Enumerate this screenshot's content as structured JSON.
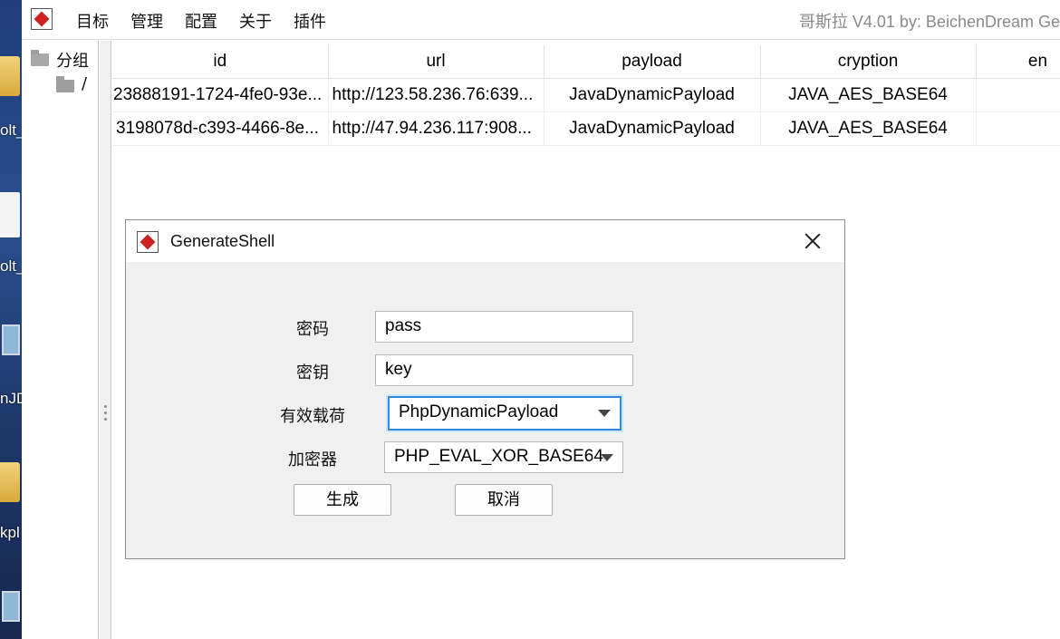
{
  "desktop": {
    "labels": [
      "olt_",
      "olt_",
      "nJD",
      "kpl"
    ]
  },
  "menubar": {
    "items": [
      "目标",
      "管理",
      "配置",
      "关于",
      "插件"
    ],
    "title": "哥斯拉   V4.01 by: BeichenDream Ge"
  },
  "tree": {
    "root_label": "分组",
    "child_label": "/"
  },
  "table": {
    "columns": [
      "id",
      "url",
      "payload",
      "cryption",
      "en"
    ],
    "rows": [
      [
        "23888191-1724-4fe0-93e...",
        "http://123.58.236.76:639...",
        "JavaDynamicPayload",
        "JAVA_AES_BASE64",
        ""
      ],
      [
        "3198078d-c393-4466-8e...",
        "http://47.94.236.117:908...",
        "JavaDynamicPayload",
        "JAVA_AES_BASE64",
        ""
      ]
    ]
  },
  "dialog": {
    "title": "GenerateShell",
    "password_label": "密码",
    "password_value": "pass",
    "key_label": "密钥",
    "key_value": "key",
    "payload_label": "有效载荷",
    "payload_value": "PhpDynamicPayload",
    "cryption_label": "加密器",
    "cryption_value": "PHP_EVAL_XOR_BASE64",
    "generate_label": "生成",
    "cancel_label": "取消"
  }
}
